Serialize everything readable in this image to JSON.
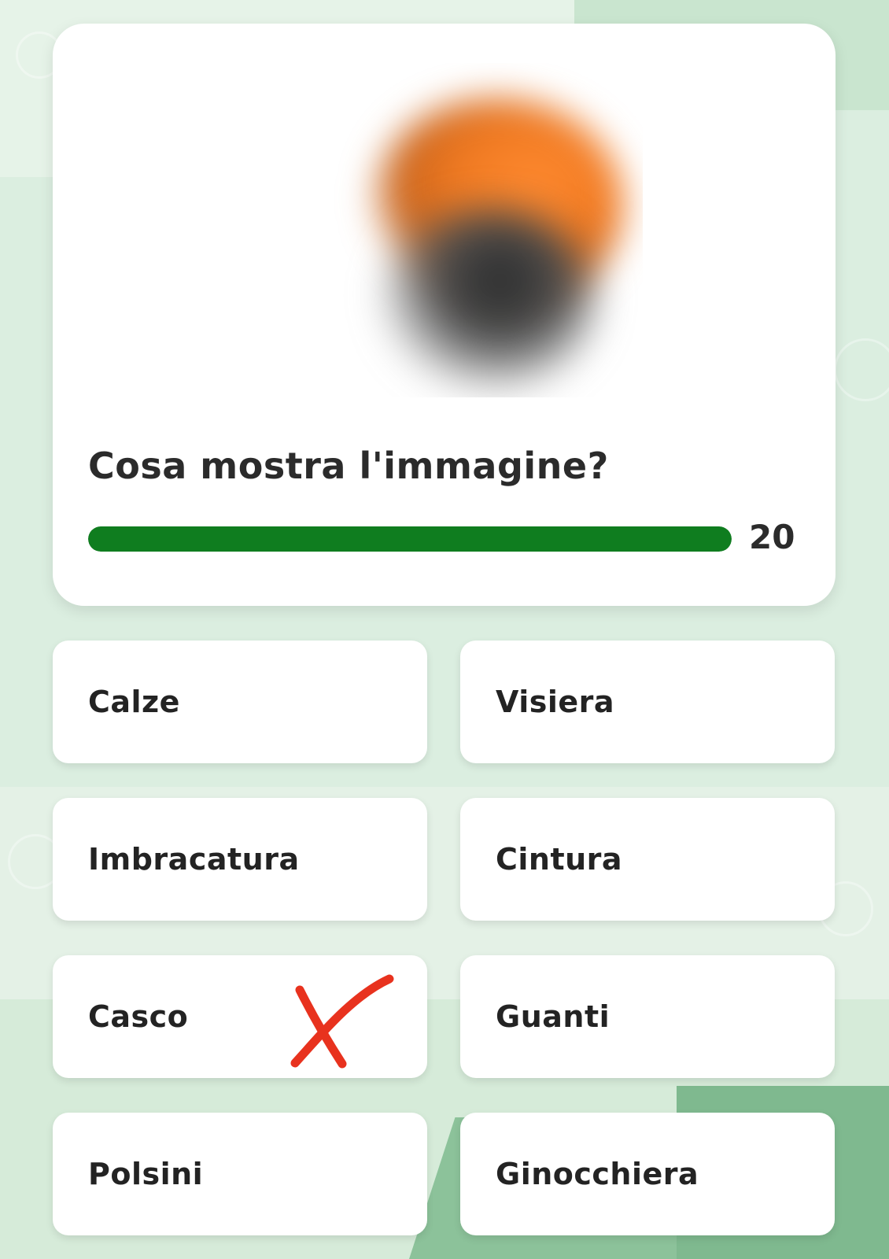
{
  "quiz": {
    "question": "Cosa mostra l'immagine?",
    "timer": "20",
    "progress_percent": 100,
    "image": {
      "state": "blurred",
      "colors": [
        "#f07a22",
        "#2a2a2a"
      ]
    }
  },
  "options": [
    {
      "label": "Calze"
    },
    {
      "label": "Visiera"
    },
    {
      "label": "Imbracatura"
    },
    {
      "label": "Cintura"
    },
    {
      "label": "Casco",
      "marked_wrong": true
    },
    {
      "label": "Guanti"
    },
    {
      "label": "Polsini"
    },
    {
      "label": "Ginocchiera"
    }
  ],
  "colors": {
    "progress": "#0f7d1f",
    "wrong_mark": "#e8321e",
    "background": "#dcefe1"
  },
  "icons": {
    "wrong_mark": "x-mark-icon"
  }
}
